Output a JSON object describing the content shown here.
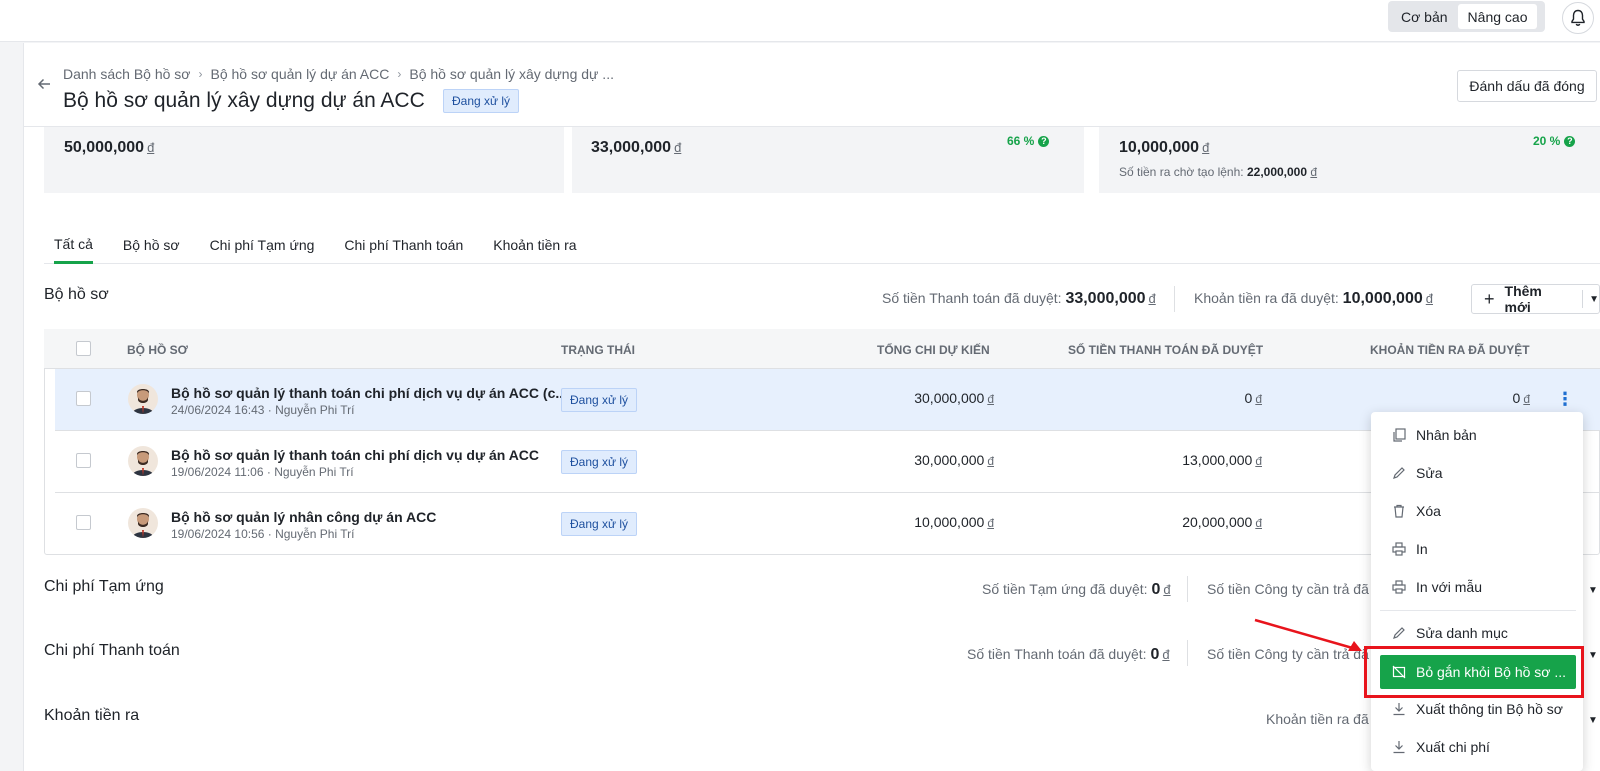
{
  "topbar": {
    "mode_basic": "Cơ bản",
    "mode_advanced": "Nâng cao",
    "bell_icon": "bell-icon"
  },
  "header": {
    "breadcrumb": [
      "Danh sách Bộ hồ sơ",
      "Bộ hồ sơ quản lý dự án ACC",
      "Bộ hồ sơ quản lý xây dựng dự ..."
    ],
    "title": "Bộ hồ sơ quản lý xây dựng dự án ACC",
    "status": "Đang xử lý",
    "close_button": "Đánh dấu đã đóng"
  },
  "stats": [
    {
      "value": "50,000,000",
      "currency": "đ"
    },
    {
      "value": "33,000,000",
      "currency": "đ",
      "percent": "66 %"
    },
    {
      "value": "10,000,000",
      "currency": "đ",
      "percent": "20 %",
      "note_label": "Số tiền ra chờ tạo lệnh:",
      "note_value": "22,000,000",
      "note_currency": "đ"
    }
  ],
  "tabs": [
    "Tất cả",
    "Bộ hồ sơ",
    "Chi phí Tạm ứng",
    "Chi phí Thanh toán",
    "Khoản tiền ra"
  ],
  "dossier_section": {
    "title": "Bộ hồ sơ",
    "paid_label": "Số tiền Thanh toán đã duyệt:",
    "paid_value": "33,000,000",
    "out_label": "Khoản tiền ra đã duyệt:",
    "out_value": "10,000,000",
    "currency": "đ",
    "add_button": "Thêm mới"
  },
  "table": {
    "columns": [
      "BỘ HỒ SƠ",
      "TRẠNG THÁI",
      "TỔNG CHI DỰ KIẾN",
      "SỐ TIỀN THANH TOÁN ĐÃ DUYỆT",
      "KHOẢN TIỀN RA ĐÃ DUYỆT"
    ],
    "rows": [
      {
        "title": "Bộ hồ sơ quản lý thanh toán chi phí dịch vụ dự án ACC (c...",
        "sub": "24/06/2024 16:43 · Nguyễn Phi Trí",
        "status": "Đang xử lý",
        "total": "30,000,000",
        "paid": "0",
        "out": "0"
      },
      {
        "title": "Bộ hồ sơ quản lý thanh toán chi phí dịch vụ dự án ACC",
        "sub": "19/06/2024 11:06 · Nguyễn Phi Trí",
        "status": "Đang xử lý",
        "total": "30,000,000",
        "paid": "13,000,000",
        "out": ""
      },
      {
        "title": "Bộ hồ sơ quản lý nhân công dự án ACC",
        "sub": "19/06/2024 10:56 · Nguyễn Phi Trí",
        "status": "Đang xử lý",
        "total": "10,000,000",
        "paid": "20,000,000",
        "out": ""
      }
    ],
    "currency": "đ"
  },
  "advance_section": {
    "title": "Chi phí Tạm ứng",
    "approved_label": "Số tiền Tạm ứng đã duyệt:",
    "approved_value": "0",
    "company_label": "Số tiền Công ty cần trả đã",
    "currency": "đ"
  },
  "payment_section": {
    "title": "Chi phí Thanh toán",
    "approved_label": "Số tiền Thanh toán đã duyệt:",
    "approved_value": "0",
    "company_label": "Số tiền Công ty cần trả đã",
    "currency": "đ"
  },
  "outflow_section": {
    "title": "Khoản tiền ra",
    "label": "Khoản tiền ra đã"
  },
  "context_menu": {
    "items": [
      "Nhân bản",
      "Sửa",
      "Xóa",
      "In",
      "In với mẫu",
      "Sửa danh mục",
      "Bỏ gắn khỏi Bộ hồ sơ ...",
      "Xuất thông tin Bộ hồ sơ",
      "Xuất chi phí"
    ],
    "icons": [
      "copy-icon",
      "pencil-icon",
      "trash-icon",
      "printer-icon",
      "printer-icon",
      "pencil-icon",
      "unlink-icon",
      "download-icon",
      "download-icon"
    ],
    "highlight_color": "#16a34a",
    "annotation_color": "#e8141c"
  }
}
